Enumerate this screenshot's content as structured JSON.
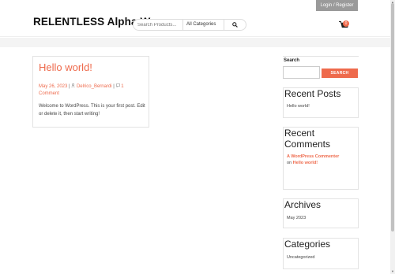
{
  "topbar": {
    "login_label": "Login / Register"
  },
  "header": {
    "site_title": "RELENTLESS Alpha Wear",
    "search_placeholder": "Search Products...",
    "category_select": "All Categories",
    "cart_count": "0",
    "cart_icon": "cart-icon",
    "search_icon": "search-icon"
  },
  "post": {
    "title": "Hello world!",
    "date": "May 26, 2023",
    "author": "Delrico_Bernardi",
    "comments": "1 Comment",
    "excerpt": "Welcome to WordPress. This is your first post. Edit or delete it, then start writing!"
  },
  "sidebar": {
    "search_label": "Search",
    "search_button": "SEARCH",
    "recent_posts_title": "Recent Posts",
    "recent_posts": [
      "Hello world!"
    ],
    "recent_comments_title": "Recent Comments",
    "recent_comment": {
      "author": "A WordPress Commenter",
      "on": "on",
      "post": "Hello world!"
    },
    "archives_title": "Archives",
    "archives": [
      "May 2023"
    ],
    "categories_title": "Categories",
    "categories": [
      "Uncategorized"
    ]
  },
  "colors": {
    "accent": "#ee6a4c",
    "login_bg": "#9a9a9a"
  }
}
